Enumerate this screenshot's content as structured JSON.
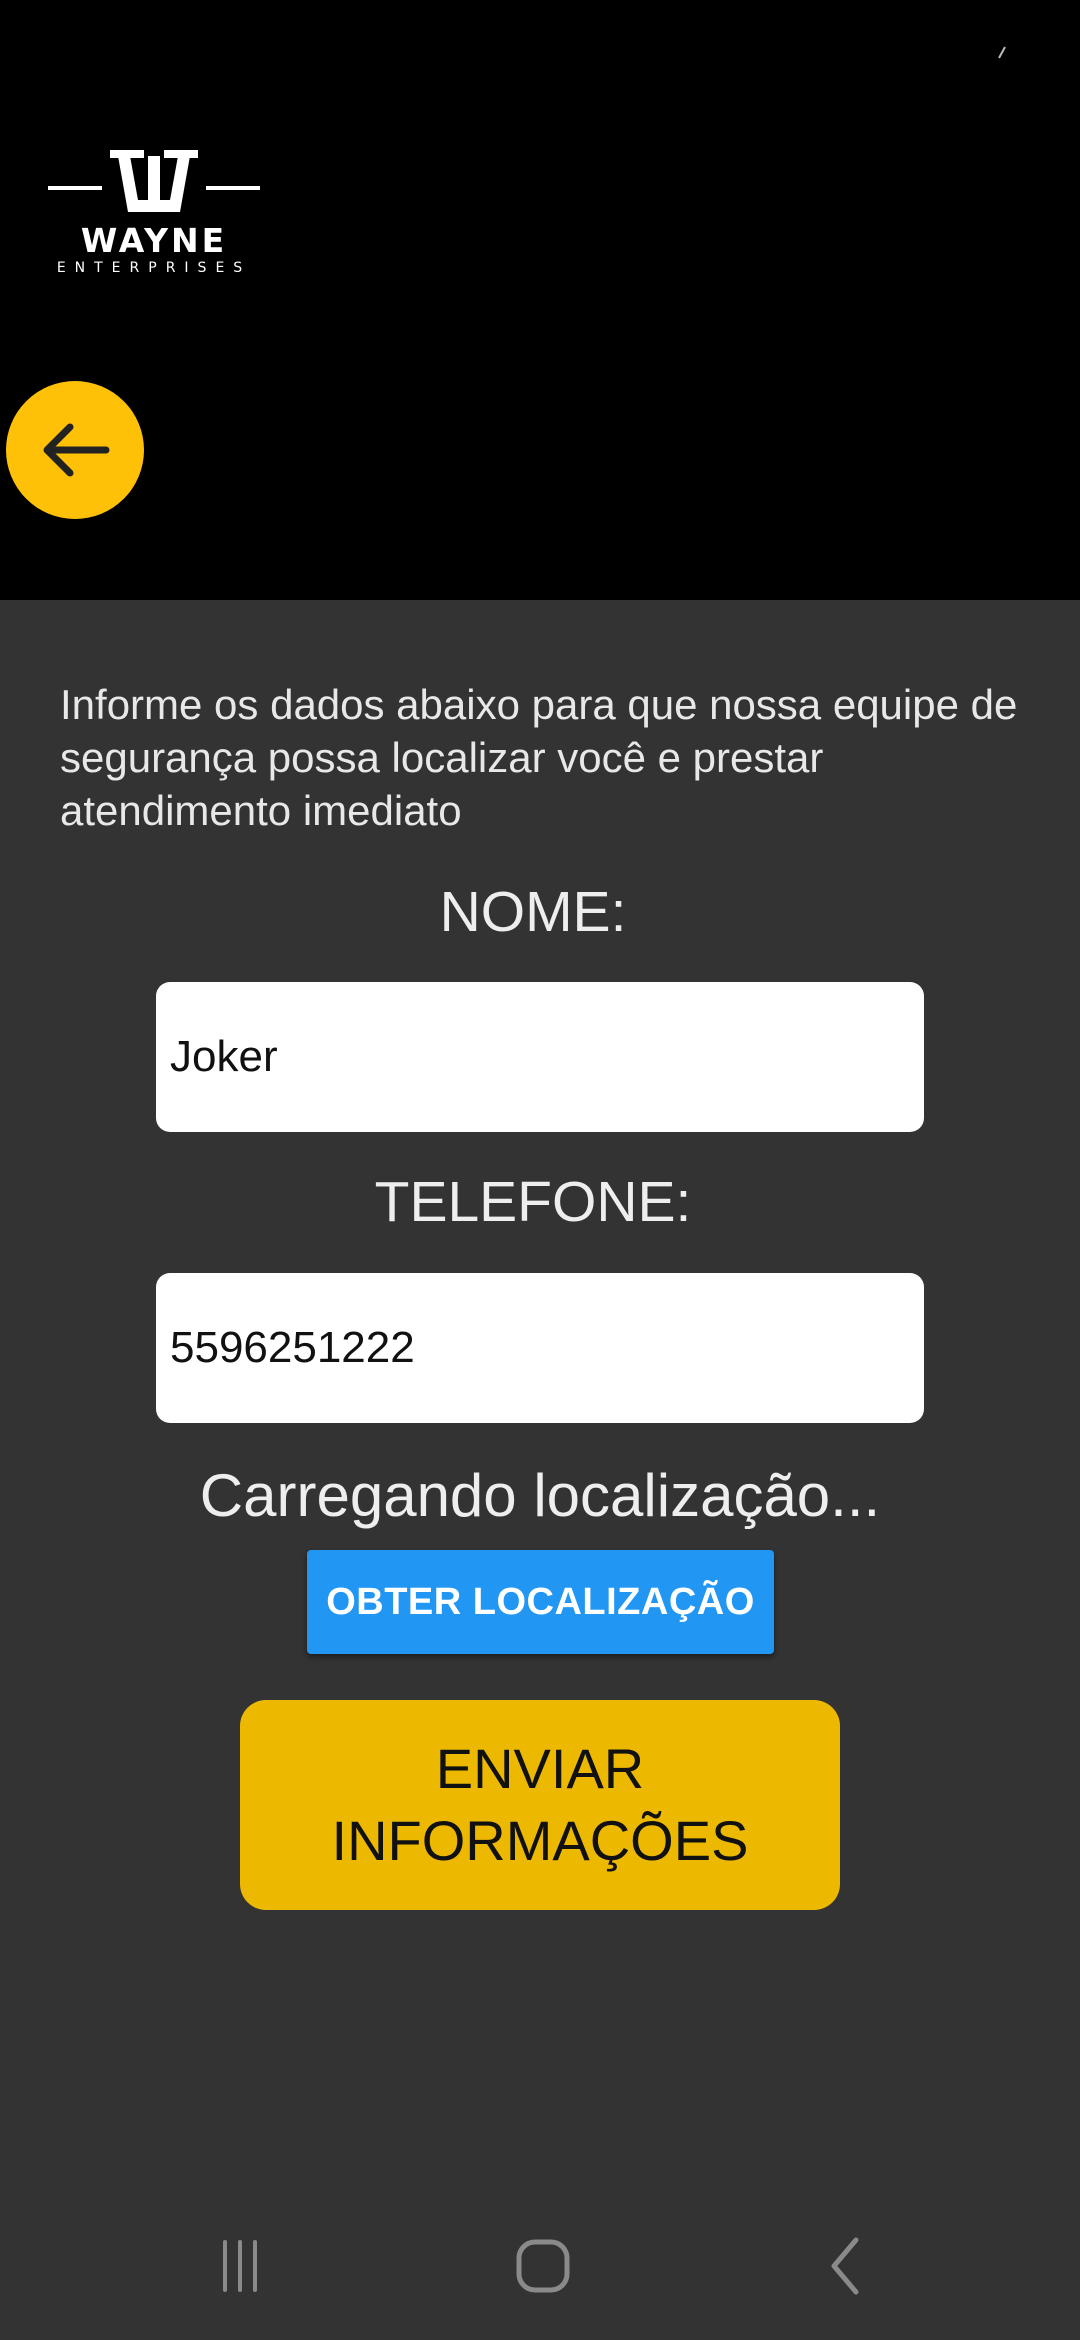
{
  "brand": {
    "wordmark": "WAYNE",
    "subwordmark": "ENTERPRISES"
  },
  "header": {
    "back_icon": "arrow-left-icon"
  },
  "form": {
    "intro": "Informe os dados abaixo para que nossa equipe de segurança possa localizar você e prestar atendimento imediato",
    "name_label": "NOME:",
    "name_value": "Joker",
    "phone_label": "TELEFONE:",
    "phone_value": "5596251222",
    "location_status": "Carregando localização...",
    "location_button": "OBTER LOCALIZAÇÃO",
    "submit_button": "ENVIAR INFORMAÇÕES"
  },
  "nav": {
    "recents_icon": "recents-icon",
    "home_icon": "home-icon",
    "back_icon": "back-chevron-icon"
  },
  "colors": {
    "header_bg": "#000000",
    "body_bg": "#333333",
    "accent_yellow": "#FFC107",
    "submit_yellow": "#ECB900",
    "button_blue": "#2196F3"
  }
}
